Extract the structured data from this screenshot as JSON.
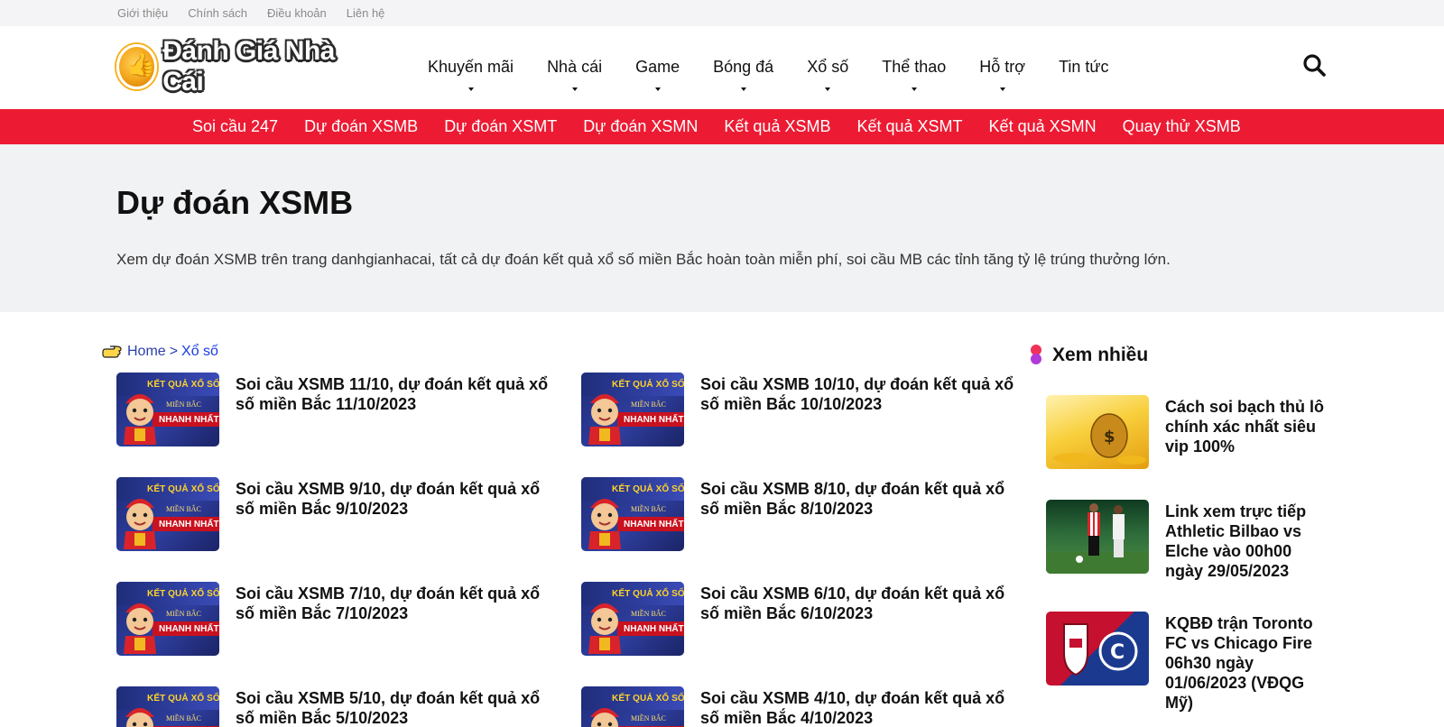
{
  "topbar": {
    "links": [
      "Giới thiệu",
      "Chính sách",
      "Điều khoản",
      "Liên hệ"
    ]
  },
  "header": {
    "logo_text": "Đánh Giá Nhà Cái",
    "nav": [
      "Khuyến mãi",
      "Nhà cái",
      "Game",
      "Bóng đá",
      "Xổ số",
      "Thể thao",
      "Hỗ trợ",
      "Tin tức"
    ],
    "nav_has_dropdown": [
      true,
      true,
      true,
      true,
      true,
      true,
      true,
      false
    ],
    "search_icon": "search-icon"
  },
  "subnav": {
    "links": [
      "Soi cầu 247",
      "Dự đoán XSMB",
      "Dự đoán XSMT",
      "Dự đoán XSMN",
      "Kết quả XSMB",
      "Kết quả XSMT",
      "Kết quả XSMN",
      "Quay thử XSMB"
    ]
  },
  "hero": {
    "title": "Dự đoán XSMB",
    "description": "Xem dự đoán XSMB trên trang danhgianhacai, tất cả dự đoán kết quả xổ số miền Bắc hoàn toàn miễn phí, soi cầu MB các tỉnh tăng tỷ lệ trúng thưởng lớn."
  },
  "breadcrumb": {
    "home": "Home",
    "separator": ">",
    "current": "Xổ số"
  },
  "thumbnail": {
    "line1": "KẾT QUẢ XỔ SỐ",
    "line2": "MIỀN BẮC",
    "line3": "NHANH NHẤT"
  },
  "posts": [
    {
      "title": "Soi cầu XSMB 11/10, dự đoán kết quả xổ số miền Bắc 11/10/2023"
    },
    {
      "title": "Soi cầu XSMB 10/10, dự đoán kết quả xổ số miền Bắc 10/10/2023"
    },
    {
      "title": "Soi cầu XSMB 9/10, dự đoán kết quả xổ số miền Bắc 9/10/2023"
    },
    {
      "title": "Soi cầu XSMB 8/10, dự đoán kết quả xổ số miền Bắc 8/10/2023"
    },
    {
      "title": "Soi cầu XSMB 7/10, dự đoán kết quả xổ số miền Bắc 7/10/2023"
    },
    {
      "title": "Soi cầu XSMB 6/10, dự đoán kết quả xổ số miền Bắc 6/10/2023"
    },
    {
      "title": "Soi cầu XSMB 5/10, dự đoán kết quả xổ số miền Bắc 5/10/2023"
    },
    {
      "title": "Soi cầu XSMB 4/10, dự đoán kết quả xổ số miền Bắc 4/10/2023"
    }
  ],
  "sidebar": {
    "title": "Xem nhiều",
    "dot_colors": [
      "#f0325a",
      "#b03ad8"
    ],
    "items": [
      {
        "title": "Cách soi bạch thủ lô chính xác nhất siêu vip 100%"
      },
      {
        "title": "Link xem trực tiếp Athletic Bilbao vs Elche vào 00h00 ngày 29/05/2023"
      },
      {
        "title": "KQBĐ trận Toronto FC vs Chicago Fire 06h30 ngày 01/06/2023 (VĐQG Mỹ)"
      }
    ]
  },
  "colors": {
    "subnav_bg": "#ec1b33",
    "hero_bg": "#f1f2f4",
    "link": "#2b3fa8"
  }
}
